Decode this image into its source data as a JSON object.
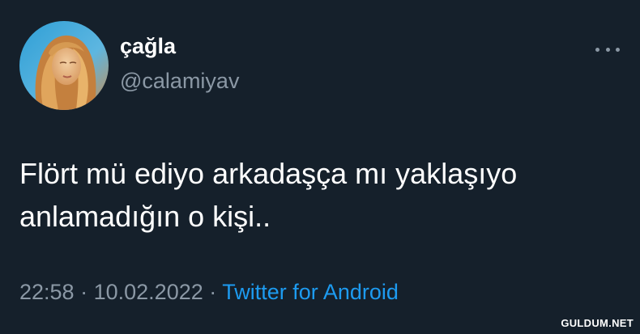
{
  "tweet": {
    "author": {
      "display_name": "çağla",
      "handle": "@calamiyav"
    },
    "text_lines": [
      "Flört mü ediyo arkadaşça mı yaklaşıyo",
      "anlamadığın o kişi.."
    ],
    "time": "22:58",
    "separator": "·",
    "date": "10.02.2022",
    "source": "Twitter for Android"
  },
  "icons": {
    "more": "more-horizontal-icon"
  },
  "watermark": "GULDUM.NET",
  "colors": {
    "background": "#15202b",
    "primary_text": "#ffffff",
    "secondary_text": "#8b98a5",
    "link": "#1d9bf0"
  }
}
